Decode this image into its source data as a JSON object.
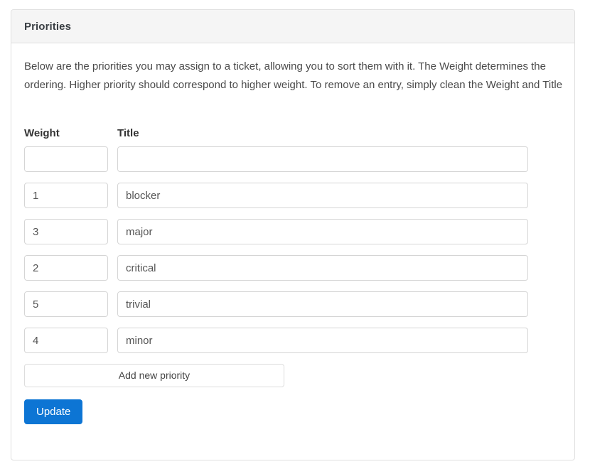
{
  "panel": {
    "title": "Priorities",
    "description": "Below are the priorities you may assign to a ticket, allowing you to sort them with it. The Weight determines the ordering. Higher priority should correspond to higher weight. To remove an entry, simply clean the Weight and Title"
  },
  "table": {
    "headers": {
      "weight": "Weight",
      "title": "Title"
    },
    "rows": [
      {
        "weight": "",
        "title": ""
      },
      {
        "weight": "1",
        "title": "blocker"
      },
      {
        "weight": "3",
        "title": "major"
      },
      {
        "weight": "2",
        "title": "critical"
      },
      {
        "weight": "5",
        "title": "trivial"
      },
      {
        "weight": "4",
        "title": "minor"
      }
    ]
  },
  "actions": {
    "add_label": "Add new priority",
    "update_label": "Update"
  },
  "colors": {
    "primary": "#0d75d4",
    "header_bg": "#f5f5f5",
    "border": "#e0e0e0",
    "input_border": "#d5d5d5",
    "text": "#333333"
  }
}
